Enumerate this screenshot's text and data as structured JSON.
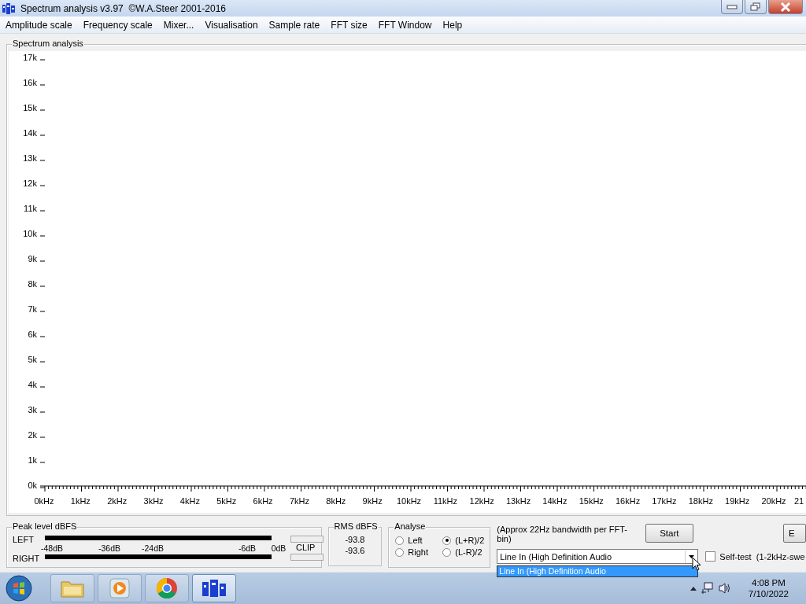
{
  "window": {
    "title": "Spectrum analysis v3.97  ©W.A.Steer 2001-2016"
  },
  "menu": [
    "Amplitude scale",
    "Frequency scale",
    "Mixer...",
    "Visualisation",
    "Sample rate",
    "FFT size",
    "FFT Window",
    "Help"
  ],
  "spectrum": {
    "title": "Spectrum analysis",
    "y_labels": [
      "17k",
      "16k",
      "15k",
      "14k",
      "13k",
      "12k",
      "11k",
      "10k",
      "9k",
      "8k",
      "7k",
      "6k",
      "5k",
      "4k",
      "3k",
      "2k",
      "1k",
      "0k"
    ],
    "x_labels": [
      "0kHz",
      "1kHz",
      "2kHz",
      "3kHz",
      "4kHz",
      "5kHz",
      "6kHz",
      "7kHz",
      "8kHz",
      "9kHz",
      "10kHz",
      "11kHz",
      "12kHz",
      "13kHz",
      "14kHz",
      "15kHz",
      "16kHz",
      "17kHz",
      "18kHz",
      "19kHz",
      "20kHz",
      "21"
    ]
  },
  "peak": {
    "title": "Peak level dBFS",
    "left_label": "LEFT",
    "right_label": "RIGHT",
    "scale": [
      "-48dB",
      "-36dB",
      "-24dB",
      "-6dB",
      "0dB"
    ],
    "clip": "CLIP"
  },
  "rms": {
    "title": "RMS dBFS",
    "values": [
      "-93.8",
      "-93.6"
    ]
  },
  "analyse": {
    "title": "Analyse",
    "options": [
      {
        "label": "Left",
        "selected": false
      },
      {
        "label": "(L+R)/2",
        "selected": true
      },
      {
        "label": "Right",
        "selected": false
      },
      {
        "label": "(L-R)/2",
        "selected": false
      }
    ]
  },
  "bandwidth_note": "(Approx 22Hz bandwidth per FFT-bin)",
  "start_button": "Start",
  "input_select": {
    "value": "Line In (High Definition Audio",
    "options": [
      {
        "label": "Line In (High Definition Audio",
        "selected": true
      }
    ]
  },
  "self_test": {
    "label": "Self-test  (1-2kHz-swe",
    "checked": false
  },
  "side_button": "E",
  "taskbar": {
    "time": "4:08 PM",
    "date": "7/10/2022"
  }
}
